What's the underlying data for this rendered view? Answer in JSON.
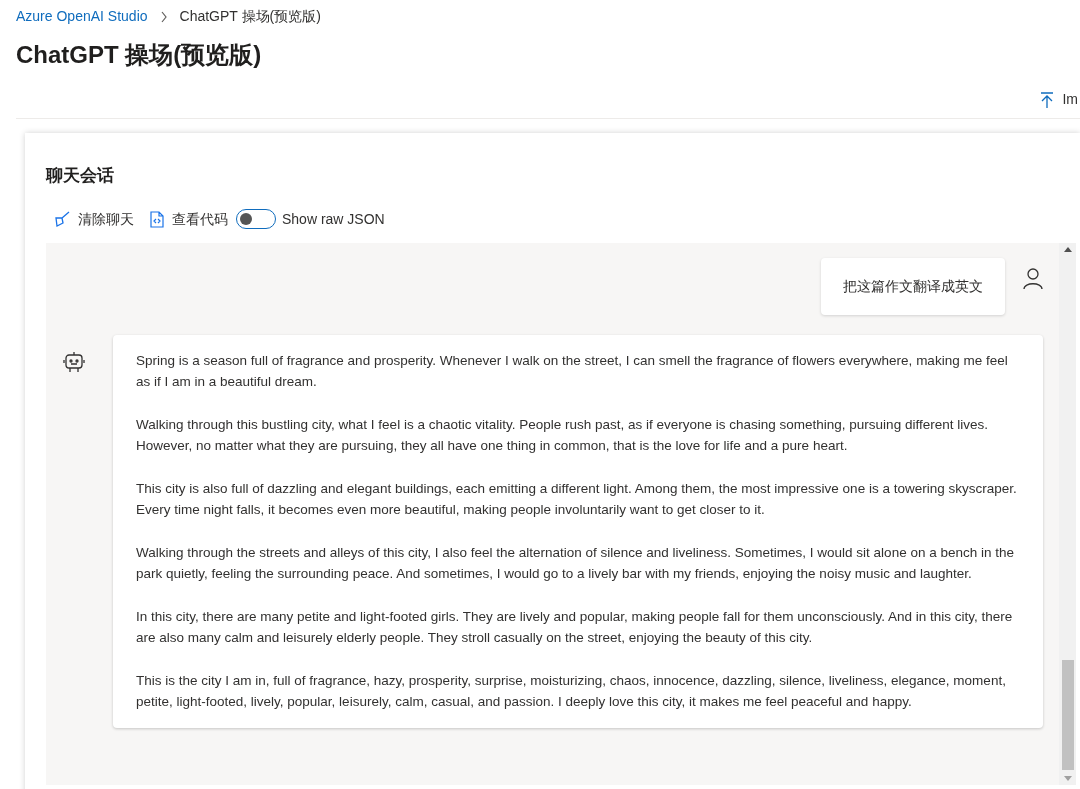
{
  "breadcrumb": [
    {
      "label": "Azure OpenAI Studio",
      "kind": "link"
    },
    {
      "label": "ChatGPT 操场(预览版)",
      "kind": "current"
    }
  ],
  "title": "ChatGPT 操场(预览版)",
  "top_action": "Im",
  "chat": {
    "heading": "聊天会话",
    "toolbar": [
      {
        "label": "清除聊天",
        "kind": "clear"
      },
      {
        "label": "查看代码",
        "kind": "code"
      }
    ],
    "raw_json_toggle": {
      "label": "Show raw JSON",
      "on": false
    },
    "messages": [
      {
        "kind": "user",
        "paragraphs": [
          "把这篇作文翻译成英文"
        ]
      },
      {
        "kind": "assistant",
        "paragraphs": [
          "Spring is a season full of fragrance and prosperity. Whenever I walk on the street, I can smell the fragrance of flowers everywhere, making me feel as if I am in a beautiful dream.",
          "Walking through this bustling city, what I feel is a chaotic vitality. People rush past, as if everyone is chasing something, pursuing different lives. However, no matter what they are pursuing, they all have one thing in common, that is the love for life and a pure heart.",
          "This city is also full of dazzling and elegant buildings, each emitting a different light. Among them, the most impressive one is a towering skyscraper. Every time night falls, it becomes even more beautiful, making people involuntarily want to get closer to it.",
          "Walking through the streets and alleys of this city, I also feel the alternation of silence and liveliness. Sometimes, I would sit alone on a bench in the park quietly, feeling the surrounding peace. And sometimes, I would go to a lively bar with my friends, enjoying the noisy music and laughter.",
          "In this city, there are many petite and light-footed girls. They are lively and popular, making people fall for them unconsciously. And in this city, there are also many calm and leisurely elderly people. They stroll casually on the street, enjoying the beauty of this city.",
          "This is the city I am in, full of fragrance, hazy, prosperity, surprise, moisturizing, chaos, innocence, dazzling, silence, liveliness, elegance, moment, petite, light-footed, lively, popular, leisurely, calm, casual, and passion. I deeply love this city, it makes me feel peaceful and happy."
        ]
      }
    ]
  }
}
